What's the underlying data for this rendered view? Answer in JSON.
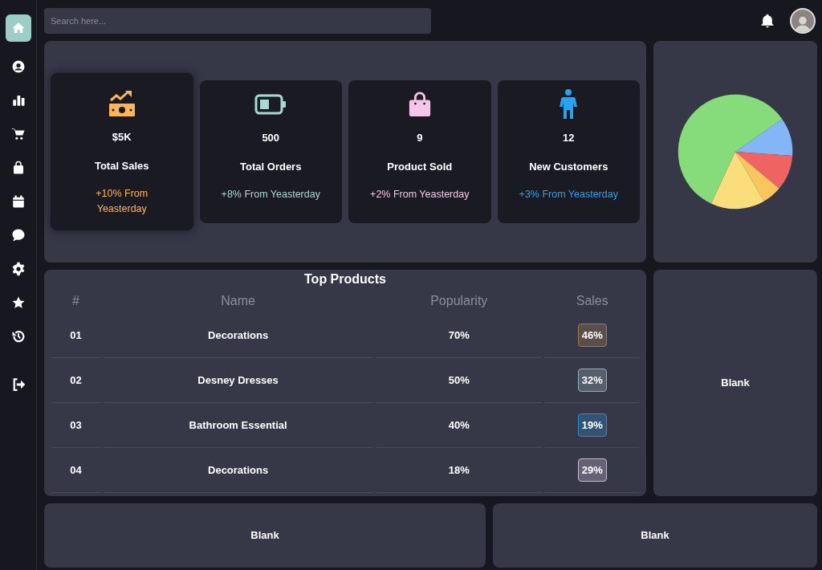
{
  "sidebar": {
    "items": [
      {
        "kind": "home",
        "selected": true
      },
      {
        "kind": "user",
        "selected": false
      },
      {
        "kind": "chart",
        "selected": false
      },
      {
        "kind": "cart",
        "selected": false
      },
      {
        "kind": "bag",
        "selected": false
      },
      {
        "kind": "calendar",
        "selected": false
      },
      {
        "kind": "chat",
        "selected": false
      },
      {
        "kind": "gear",
        "selected": false
      },
      {
        "kind": "star",
        "selected": false
      },
      {
        "kind": "history",
        "selected": false
      },
      {
        "kind": "logout",
        "selected": false
      }
    ]
  },
  "search": {
    "placeholder": "Search here..."
  },
  "stats": [
    {
      "kind": "money",
      "value": "$5K",
      "label": "Total Sales",
      "change": "+10% From Yeasterday",
      "color": "#fdb55a",
      "highlighted": true
    },
    {
      "kind": "battery",
      "value": "500",
      "label": "Total Orders",
      "change": "+8% From Yeasterday",
      "color": "#a5dbd2",
      "highlighted": false
    },
    {
      "kind": "bag",
      "value": "9",
      "label": "Product Sold",
      "change": "+2% From Yeasterday",
      "color": "#f5c6ea",
      "highlighted": false
    },
    {
      "kind": "person",
      "value": "12",
      "label": "New Customers",
      "change": "+3% From Yeasterday",
      "color": "#27a3f2",
      "highlighted": false
    }
  ],
  "top_products": {
    "title": "Top Products",
    "columns": [
      "#",
      "Name",
      "Popularity",
      "Sales"
    ],
    "rows": [
      {
        "num": "01",
        "name": "Decorations",
        "popularity": "70%",
        "sales": "46%",
        "color": "#a57a4c"
      },
      {
        "num": "02",
        "name": "Desney Dresses",
        "popularity": "50%",
        "sales": "32%",
        "color": "#8fb0b4"
      },
      {
        "num": "03",
        "name": "Bathroom Essential",
        "popularity": "40%",
        "sales": "19%",
        "color": "#2b8dd0"
      },
      {
        "num": "04",
        "name": "Decorations",
        "popularity": "18%",
        "sales": "29%",
        "color": "#c9b8d4"
      }
    ]
  },
  "side_panel": {
    "text": "Blank"
  },
  "bottom_panels": [
    {
      "text": "Blank"
    },
    {
      "text": "Blank"
    }
  ]
}
